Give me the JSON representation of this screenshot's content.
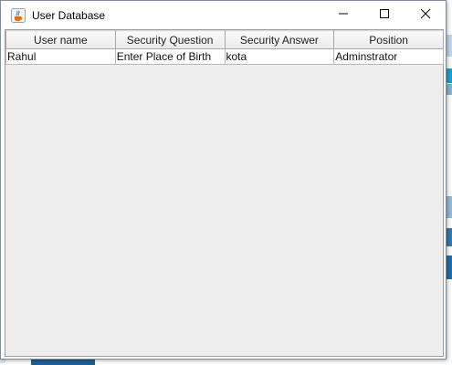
{
  "window": {
    "title": "User Database",
    "icon": "java-cup-icon",
    "controls": {
      "minimize": "minimize-icon",
      "maximize": "maximize-icon",
      "close": "close-icon"
    }
  },
  "table": {
    "columns": [
      "User name",
      "Security Question",
      "Security Answer",
      "Position"
    ],
    "rows": [
      [
        "Rahul",
        "Enter Place of Birth",
        "kota",
        "Adminstrator"
      ]
    ]
  },
  "colors": {
    "client_background": "#eeeeee",
    "window_background": "#ffffff",
    "grid_line": "#b8b8b8"
  }
}
